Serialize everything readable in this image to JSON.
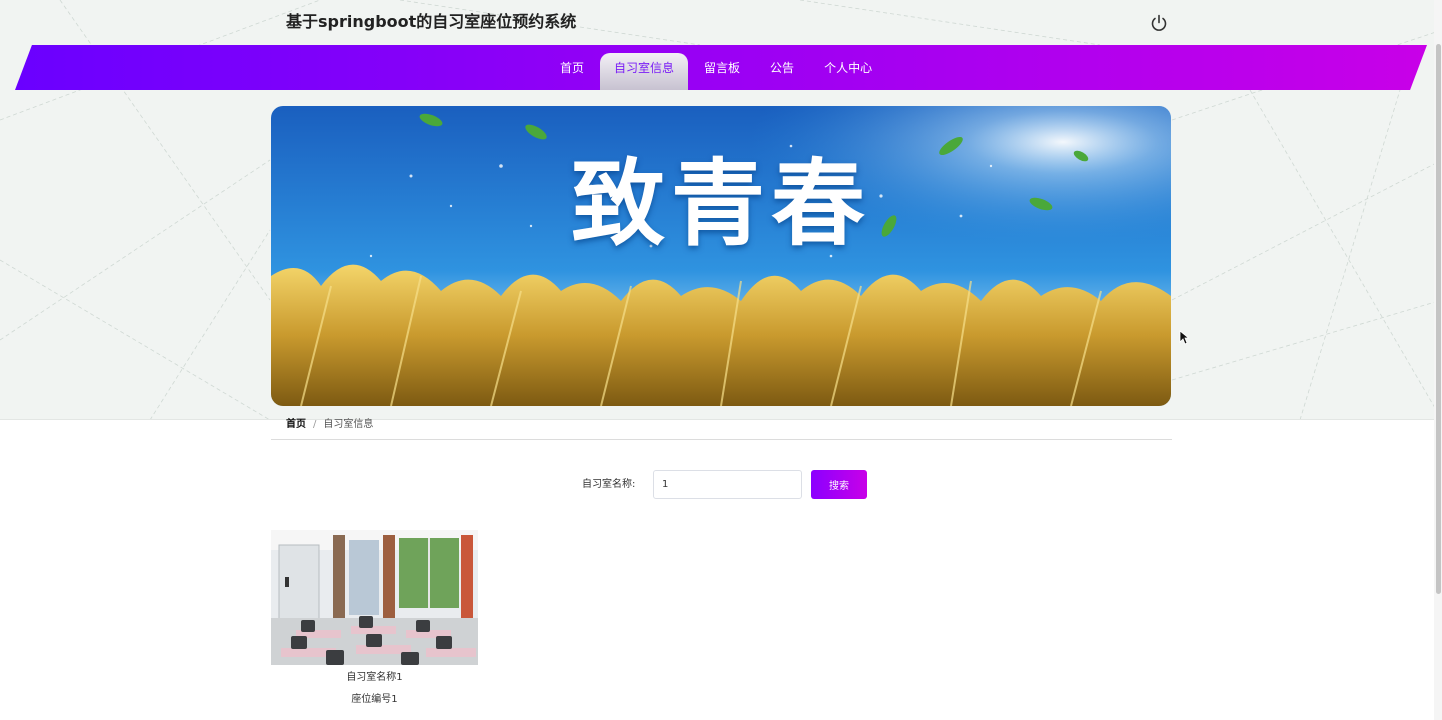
{
  "header": {
    "title": "基于springboot的自习室座位预约系统",
    "logout_icon": "power-icon"
  },
  "nav": {
    "active_index": 1,
    "items": [
      {
        "label": "首页"
      },
      {
        "label": "自习室信息"
      },
      {
        "label": "留言板"
      },
      {
        "label": "公告"
      },
      {
        "label": "个人中心"
      }
    ],
    "gradient": [
      "#6a00ff",
      "#c800e8"
    ]
  },
  "banner": {
    "title": "致青春"
  },
  "breadcrumb": {
    "home": "首页",
    "separator": "/",
    "current": "自习室信息"
  },
  "search": {
    "label": "自习室名称:",
    "value": "1",
    "button_label": "搜索"
  },
  "rooms": [
    {
      "name": "自习室名称1",
      "seat": "座位编号1"
    }
  ],
  "colors": {
    "accent": "#8b00ff",
    "accent_end": "#c800e8"
  }
}
